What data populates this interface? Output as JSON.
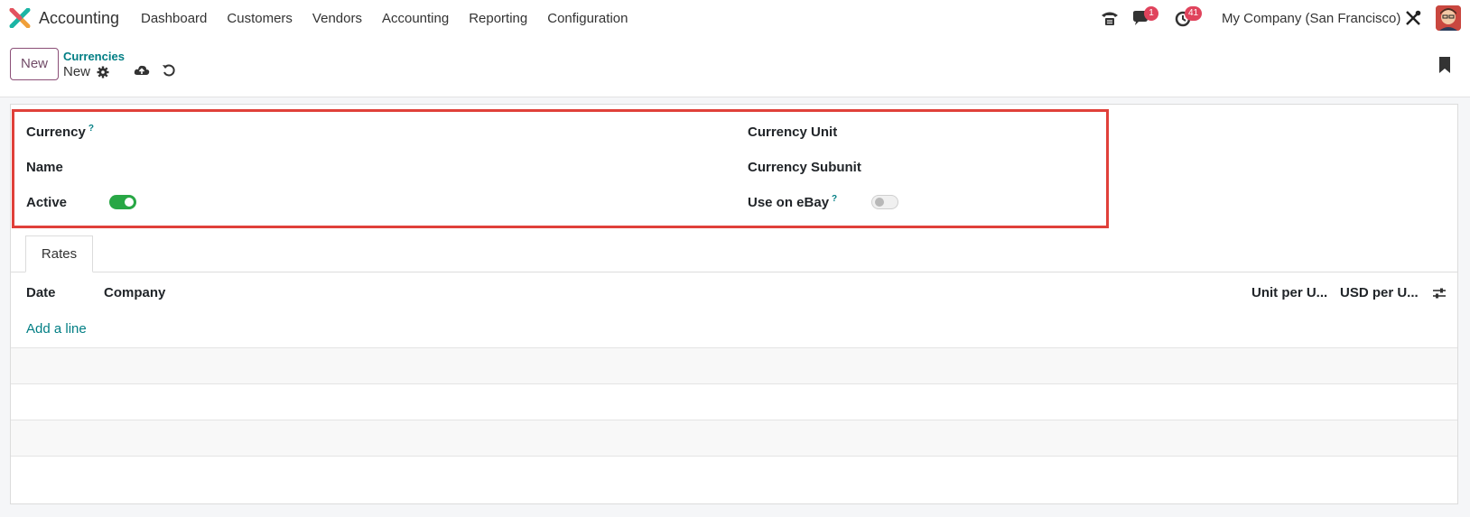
{
  "navbar": {
    "app_name": "Accounting",
    "menu": [
      "Dashboard",
      "Customers",
      "Vendors",
      "Accounting",
      "Reporting",
      "Configuration"
    ],
    "chat_badge": "1",
    "activity_badge": "41",
    "company": "My Company (San Francisco)"
  },
  "control": {
    "new_label": "New",
    "breadcrumb_parent": "Currencies",
    "breadcrumb_current": "New"
  },
  "form": {
    "currency_label": "Currency",
    "name_label": "Name",
    "active_label": "Active",
    "currency_unit_label": "Currency Unit",
    "currency_subunit_label": "Currency Subunit",
    "use_on_ebay_label": "Use on eBay",
    "help_mark": "?",
    "active": true,
    "use_on_ebay": false
  },
  "tabs": [
    "Rates"
  ],
  "rates_table": {
    "columns": [
      "Date",
      "Company",
      "Unit per U...",
      "USD per U..."
    ],
    "add_line": "Add a line"
  },
  "colors": {
    "brand": "#714b67",
    "link": "#017e84",
    "toggle_on": "#28a745",
    "highlight": "#e0403a",
    "badge": "#e0435c"
  }
}
